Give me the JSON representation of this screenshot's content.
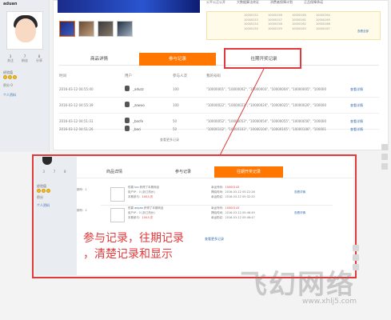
{
  "top_panel": {
    "username": "aduan",
    "stats": [
      {
        "value": "3",
        "label": "关注"
      },
      {
        "value": "7",
        "label": "粉丝"
      },
      {
        "value": "8",
        "label": "分享"
      }
    ],
    "sidebar_lines": [
      "经验值",
      "积分",
      "个人资料"
    ],
    "points_value": "0",
    "header_links": [
      "公平公正公开",
      "大数据算法终证",
      "消费者保障计划",
      "正品保障承诺"
    ],
    "lucky_numbers": [
      "10000152",
      "10000153",
      "10000154",
      "10000155",
      "10000156",
      "10000157",
      "10000158",
      "10000159",
      "10000160",
      "10000161",
      "10000162",
      "10000163",
      "10000164",
      "10000165",
      "10000166",
      "10000167"
    ],
    "view_all": "查看全部",
    "tabs": {
      "detail": "商品详情",
      "records": "参与记录",
      "history": "往期开奖记录"
    },
    "table_headers": [
      "时间",
      "用户",
      "参与人次",
      "我的号码"
    ],
    "rows": [
      {
        "time": "2016-03-12 04:55:40",
        "user": "_aduzz",
        "count": "100",
        "codes": "\"10000001\", \"10000002\", \"10000003\", \"10000004\", \"10000005\", \"10000006\"",
        "link": "查看详情"
      },
      {
        "time": "2016-03-12 04:55:39",
        "user": "_zowuo",
        "count": "100",
        "codes": "\"10000022\", \"10000023\", \"10000024\", \"10000025\", \"10000026\", \"10000027\"",
        "link": "查看详情"
      },
      {
        "time": "2016-03-12 04:51:31",
        "user": "_bacfe",
        "count": "50",
        "codes": "\"10000052\", \"10000053\", \"10000054\", \"10000055\", \"10000056\", \"10000057\"",
        "link": "查看详情"
      },
      {
        "time": "2016-03-12 04:51:26",
        "user": "_baci",
        "count": "50",
        "codes": "\"10000102\", \"10000103\", \"10000104\", \"10000105\", \"10000106\", \"10000107\"",
        "link": "查看详情"
      }
    ],
    "more": "查看更多记录"
  },
  "bottom_panel": {
    "stats": [
      "3",
      "7",
      "8"
    ],
    "tabs": {
      "detail": "商品详情",
      "records": "参与记录",
      "history": "往期开奖记录"
    },
    "records": [
      {
        "period": "期号：1",
        "winner_prefix": "恒喜",
        "user": "luo",
        "action": "获得了本期商品",
        "ip": "用户IP：0 (浙江杭州)",
        "count_label": "本期参与：",
        "count": "100人次",
        "lucky_label": "幸运号码：",
        "lucky": "10000143",
        "publish": "揭晓时间：2016-03-12 05:22:28",
        "buy": "幸运购买：2016-03-12 05:32:20",
        "link": "查看详情"
      },
      {
        "period": "期号：2",
        "winner_prefix": "恒喜",
        "user": "aoyao",
        "action": "获得了本期商品",
        "ip": "用户IP：0 (浙江杭州)",
        "count_label": "本期参与：",
        "count": "100人次",
        "lucky_label": "幸运号码：",
        "lucky": "10000143",
        "publish": "揭晓时间：2016-03-12 05:46:49",
        "buy": "幸运购买：2016-03-12 05:46:47",
        "link": "查看详情"
      }
    ],
    "more": "查看更多记录"
  },
  "annotation": {
    "line1": "参与记录，往期记录",
    "line2": "，清楚记录和显示"
  },
  "watermark": {
    "text": "飞幻网络",
    "url": "www.xhlj5.com"
  },
  "colors": {
    "accent": "#ff7600",
    "highlight": "#e4393c"
  }
}
